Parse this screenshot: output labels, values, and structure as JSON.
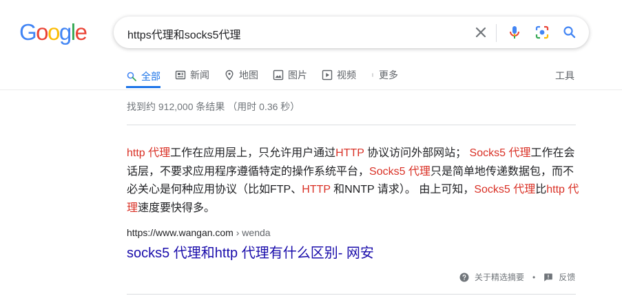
{
  "logo": {
    "letters": [
      "G",
      "o",
      "o",
      "g",
      "l",
      "e"
    ],
    "colors": [
      "#4285F4",
      "#EA4335",
      "#FBBC05",
      "#4285F4",
      "#34A853",
      "#EA4335"
    ]
  },
  "search": {
    "query": "https代理和socks5代理",
    "icons": [
      "close-icon",
      "mic-icon",
      "camera-lens-icon",
      "search-icon"
    ]
  },
  "tabs": [
    {
      "label": "全部",
      "icon": "search-icon",
      "active": true
    },
    {
      "label": "新闻",
      "icon": "news-icon",
      "active": false
    },
    {
      "label": "地图",
      "icon": "map-pin-icon",
      "active": false
    },
    {
      "label": "图片",
      "icon": "image-icon",
      "active": false
    },
    {
      "label": "视频",
      "icon": "video-icon",
      "active": false
    },
    {
      "label": "更多",
      "icon": "more-vert-icon",
      "active": false
    }
  ],
  "tools_label": "工具",
  "stats": "找到约 912,000 条结果 （用时 0.36 秒）",
  "snippet": {
    "p01": "http 代理",
    "p02": "工作在应用层上，只允许用户通过",
    "p03": "HTTP",
    "p04": " 协议访问外部网站； ",
    "p05": "Socks5 代理",
    "p06": "工作在会话层，不要求应用程序遵循特定的操作系统平台，",
    "p07": "Socks5 代理",
    "p08": "只是简单地传递数据包，而不必关心是何种应用协议（比如FTP、",
    "p09": "HTTP",
    "p10": " 和NNTP 请求）。 由上可知，",
    "p11": "Socks5 代理",
    "p12": "比",
    "p13": "http 代理",
    "p14": "速度要快得多。"
  },
  "result": {
    "url": "https://www.wangan.com",
    "breadcrumb": " › wenda",
    "title": "socks5 代理和http 代理有什么区别- 网安"
  },
  "footer": {
    "about": "关于精选摘要",
    "separator": "•",
    "feedback": "反馈"
  },
  "colors": {
    "accent": "#1a73e8",
    "highlight": "#d93025",
    "link": "#1a0dab",
    "muted": "#70757a"
  }
}
